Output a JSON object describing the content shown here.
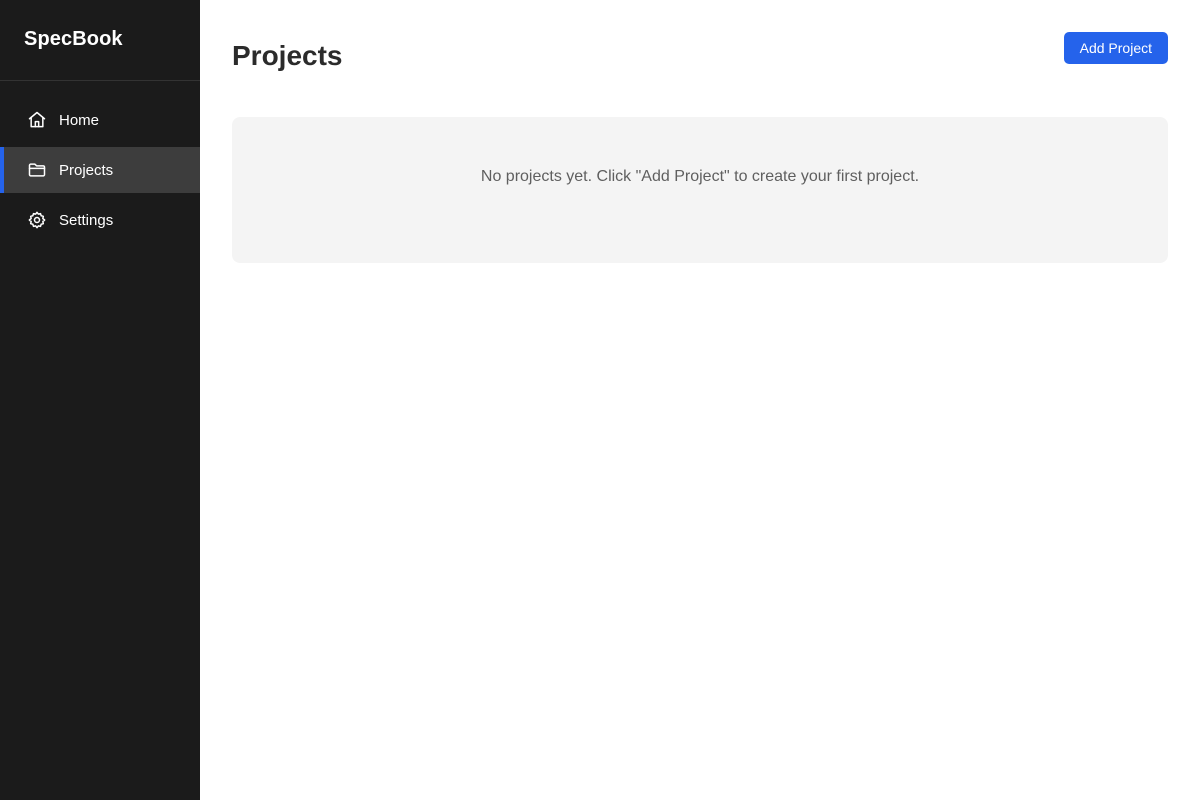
{
  "app": {
    "name": "SpecBook"
  },
  "sidebar": {
    "items": [
      {
        "label": "Home",
        "icon": "home-icon",
        "active": false
      },
      {
        "label": "Projects",
        "icon": "folder-icon",
        "active": true
      },
      {
        "label": "Settings",
        "icon": "gear-icon",
        "active": false
      }
    ]
  },
  "main": {
    "title": "Projects",
    "add_button_label": "Add Project",
    "empty_message": "No projects yet. Click \"Add Project\" to create your first project."
  },
  "colors": {
    "sidebar_bg": "#1b1b1b",
    "accent": "#2563eb",
    "active_item_bg": "#3d3d3d",
    "empty_state_bg": "#f4f4f4"
  }
}
